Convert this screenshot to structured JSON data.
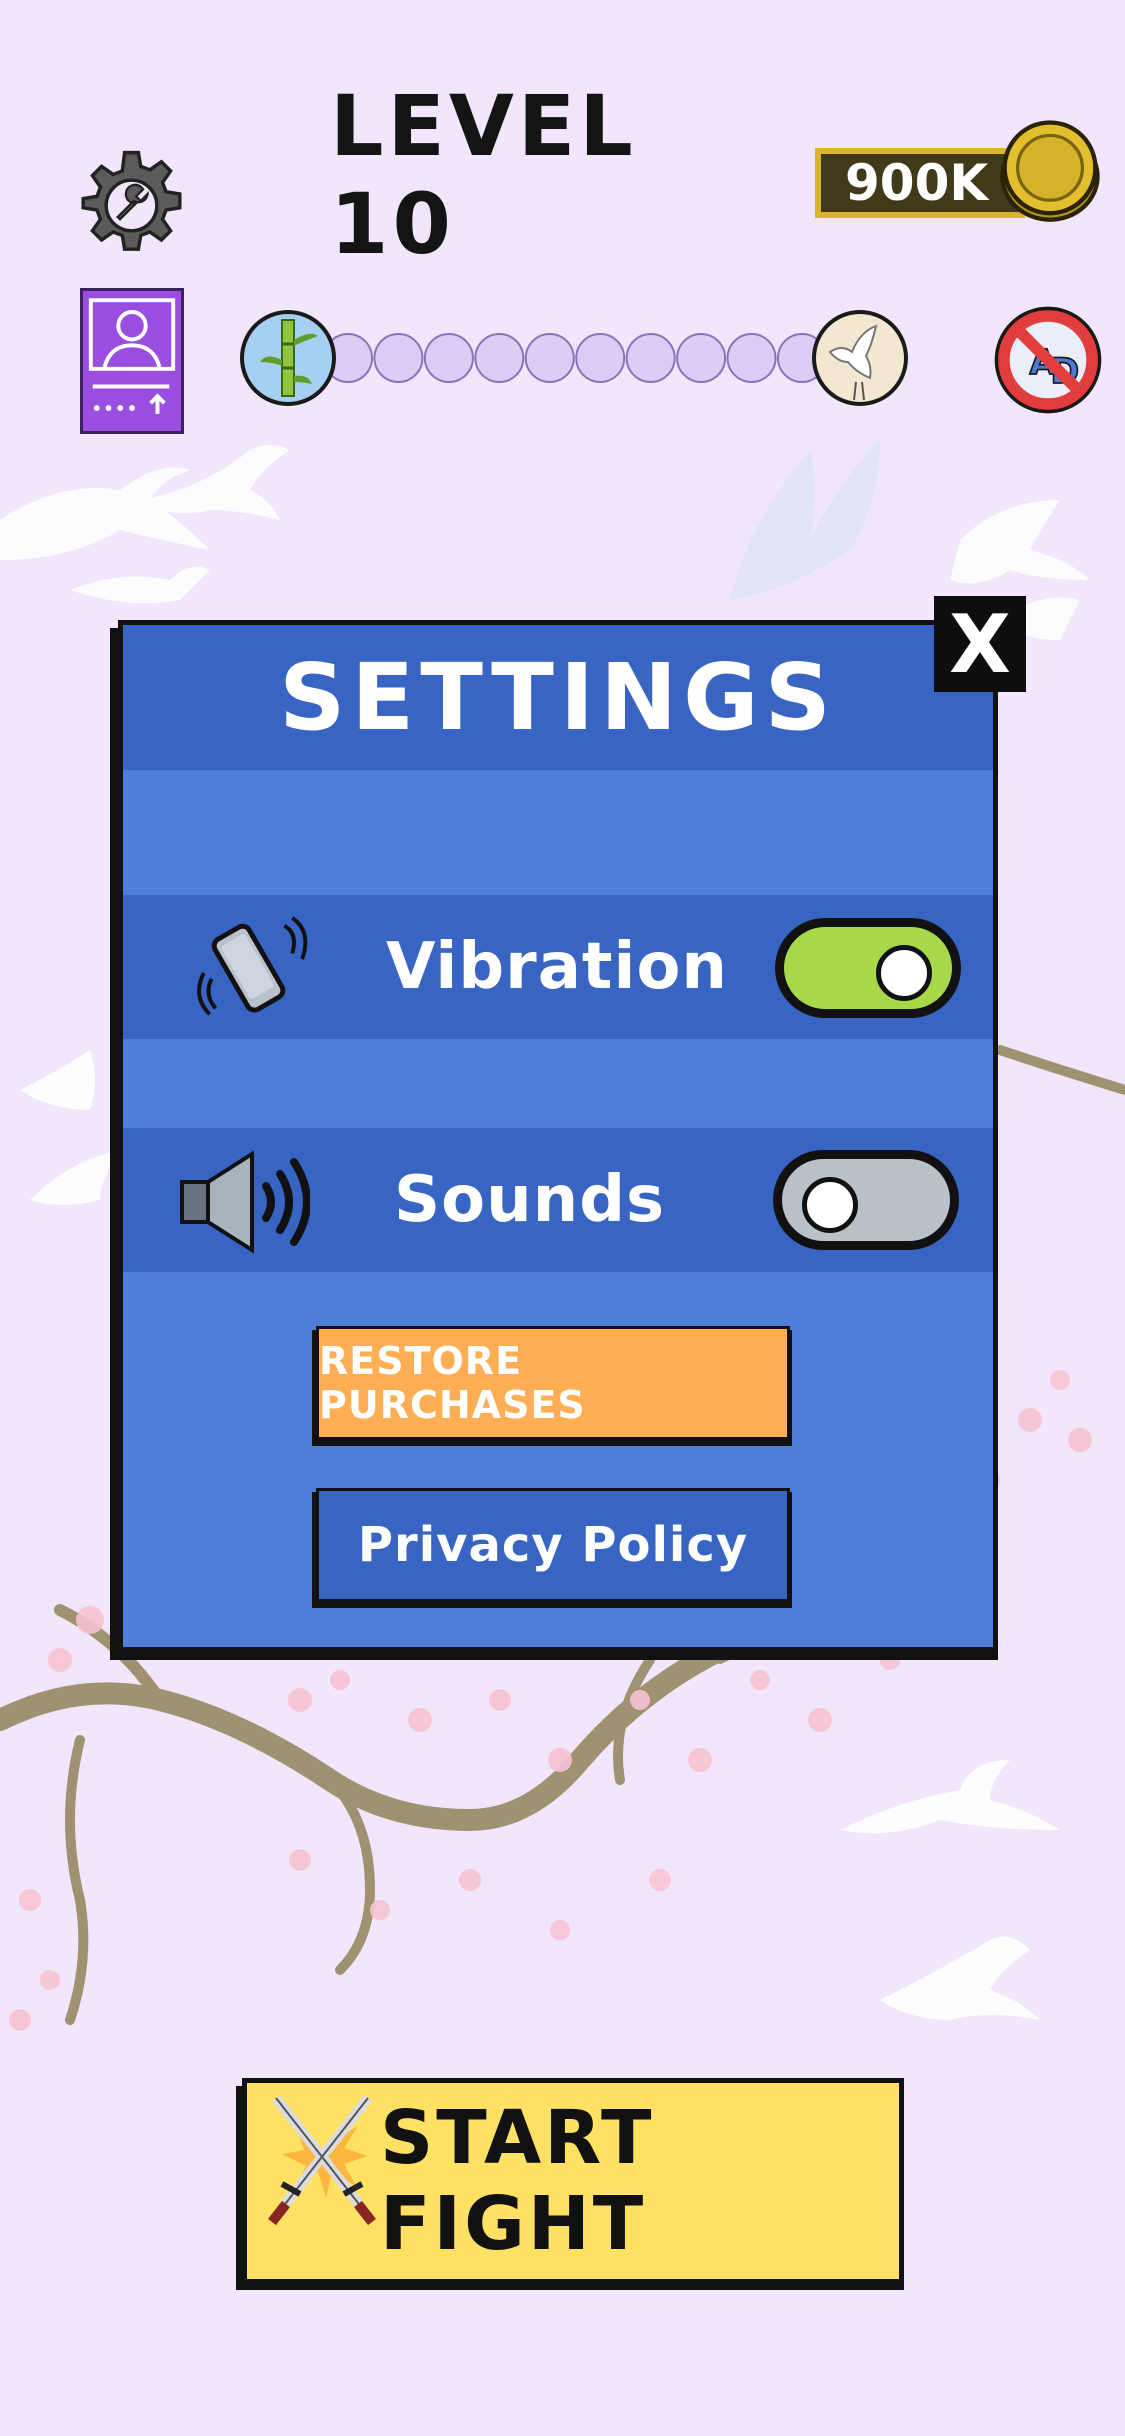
{
  "header": {
    "level_title": "LEVEL 10",
    "coins": "900K",
    "icons": {
      "settings": "gear-wrench-icon",
      "coin": "coin-icon",
      "profile": "profile-card-icon",
      "no_ads": "no-ads-icon",
      "progress_start": "bamboo-icon",
      "progress_end": "crane-icon"
    },
    "progress": {
      "completed_steps": 0,
      "total_steps": 10
    }
  },
  "settings_modal": {
    "title": "SETTINGS",
    "close_label": "X",
    "vibration": {
      "label": "Vibration",
      "enabled": true,
      "icon": "vibrating-phone-icon"
    },
    "sounds": {
      "label": "Sounds",
      "enabled": false,
      "icon": "speaker-icon"
    },
    "restore_label": "RESTORE PURCHASES",
    "privacy_label": "Privacy Policy"
  },
  "start_fight": {
    "label": "START FIGHT",
    "icon": "crossed-swords-icon"
  },
  "colors": {
    "background": "#f1e6fb",
    "modal": "#4e7edb",
    "modal_dark": "#3864c4",
    "toggle_on": "#a6d94a",
    "toggle_off": "#b9c1c9",
    "restore": "#ffae54",
    "start_fight": "#ffe163"
  }
}
